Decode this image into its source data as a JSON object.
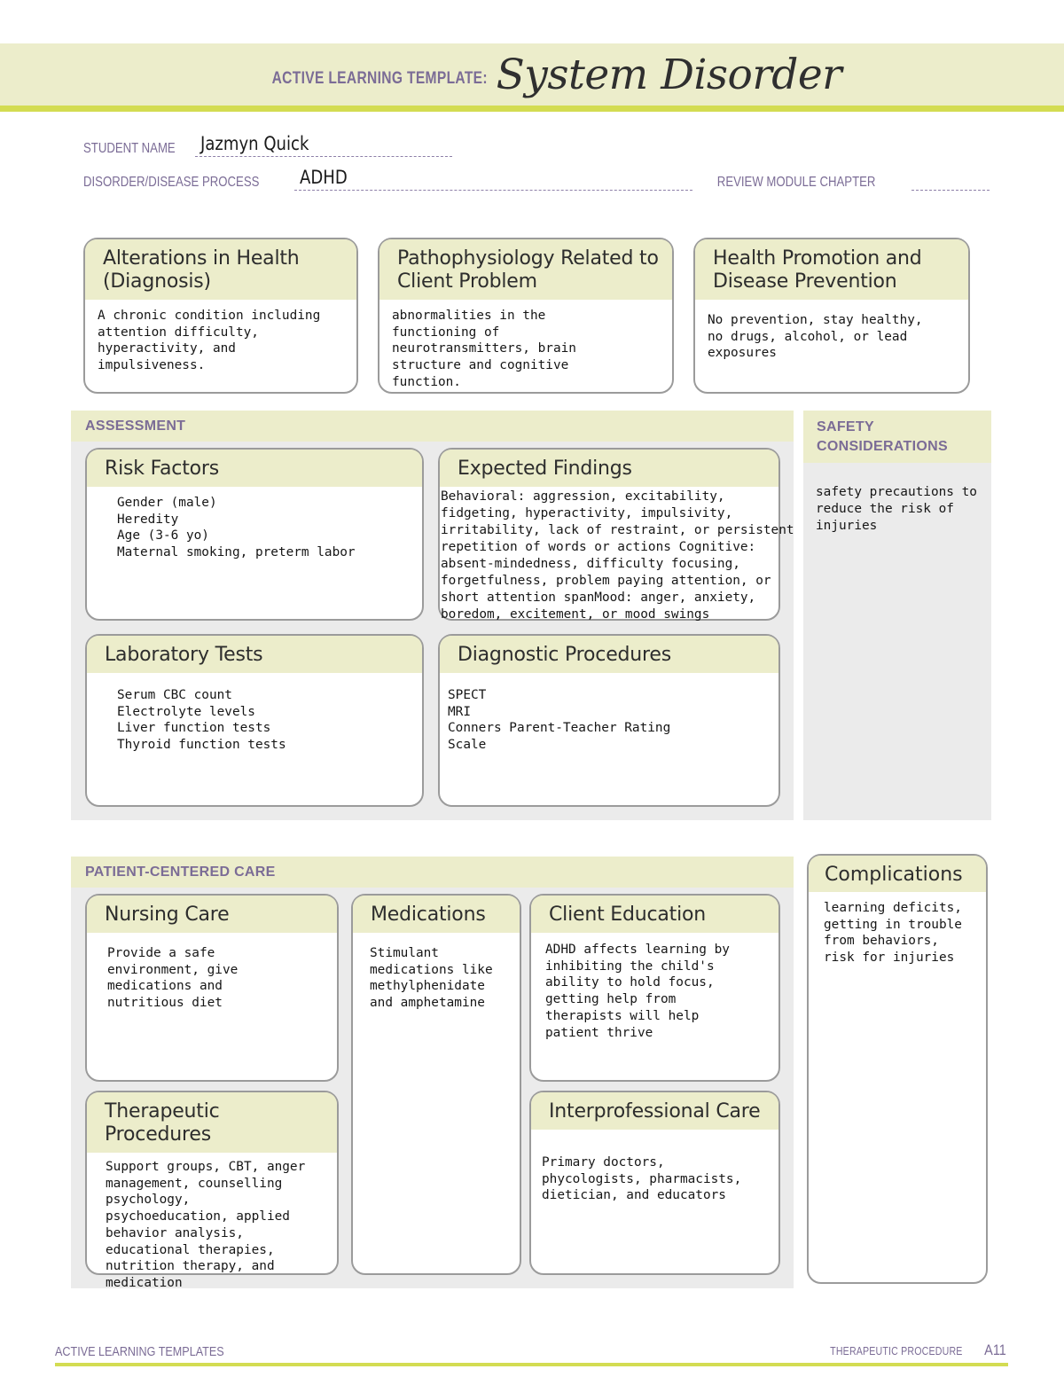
{
  "header": {
    "template_label": "ACTIVE LEARNING TEMPLATE:",
    "title": "System Disorder",
    "band_color": "#ecedcb",
    "rule_color": "#d3dc52"
  },
  "form": {
    "student_name_label": "STUDENT NAME",
    "student_name_value": "Jazmyn Quick",
    "disorder_label": "DISORDER/DISEASE PROCESS",
    "disorder_value": "ADHD",
    "review_module_label": "REVIEW MODULE CHAPTER",
    "review_module_value": ""
  },
  "top_cards": {
    "alterations": {
      "title": "Alterations in\nHealth (Diagnosis)",
      "body": "A chronic condition including\nattention difficulty,\nhyperactivity, and\nimpulsiveness."
    },
    "pathophysiology": {
      "title": "Pathophysiology Related\nto Client Problem",
      "body": "abnormalities in the\nfunctioning of\nneurotransmitters, brain\nstructure and cognitive\nfunction."
    },
    "health_promotion": {
      "title": "Health Promotion and\nDisease Prevention",
      "body": "No prevention, stay healthy,\nno drugs, alcohol, or lead\nexposures"
    }
  },
  "assessment": {
    "section_label": "ASSESSMENT",
    "risk_factors": {
      "title": "Risk Factors",
      "body": "Gender (male)\nHeredity\nAge (3-6 yo)\nMaternal smoking, preterm labor"
    },
    "expected_findings": {
      "title": "Expected Findings",
      "body": "Behavioral: aggression, excitability, fidgeting, hyperactivity, impulsivity, irritability, lack of restraint, or persistent repetition of words or actions Cognitive: absent-mindedness, difficulty focusing, forgetfulness, problem paying attention, or short attention spanMood: anger, anxiety, boredom, excitement, or mood swings"
    },
    "laboratory_tests": {
      "title": "Laboratory Tests",
      "body": "Serum CBC count\nElectrolyte levels\nLiver function tests\nThyroid function tests"
    },
    "diagnostic_procedures": {
      "title": "Diagnostic Procedures",
      "body": "SPECT\nMRI\nConners Parent-Teacher Rating\nScale"
    }
  },
  "safety": {
    "section_label_line1": "SAFETY",
    "section_label_line2": "CONSIDERATIONS",
    "body": "safety precautions to\nreduce the risk of\ninjuries"
  },
  "patient_centered_care": {
    "section_label": "PATIENT-CENTERED CARE",
    "nursing_care": {
      "title": "Nursing Care",
      "body": "Provide a safe\nenvironment, give\nmedications and\nnutritious diet"
    },
    "medications": {
      "title": "Medications",
      "body": "Stimulant\nmedications like\nmethylphenidate\nand amphetamine"
    },
    "client_education": {
      "title": "Client Education",
      "body": "ADHD affects learning by\ninhibiting the child's\nability to hold focus,\ngetting help from\ntherapists will help\npatient thrive"
    },
    "therapeutic_procedures": {
      "title": "Therapeutic Procedures",
      "body": "Support groups, CBT, anger\nmanagement, counselling\npsychology,\npsychoeducation, applied\nbehavior analysis,\neducational therapies,\nnutrition therapy, and\nmedication"
    },
    "interprofessional_care": {
      "title": "Interprofessional Care",
      "body": "Primary doctors,\nphycologists, pharmacists,\ndietician, and educators"
    }
  },
  "complications": {
    "title": "Complications",
    "body": "learning deficits,\ngetting in trouble\nfrom behaviors,\nrisk for injuries"
  },
  "footer": {
    "left": "ACTIVE LEARNING TEMPLATES",
    "section": "THERAPEUTIC PROCEDURE",
    "page": "A11"
  }
}
